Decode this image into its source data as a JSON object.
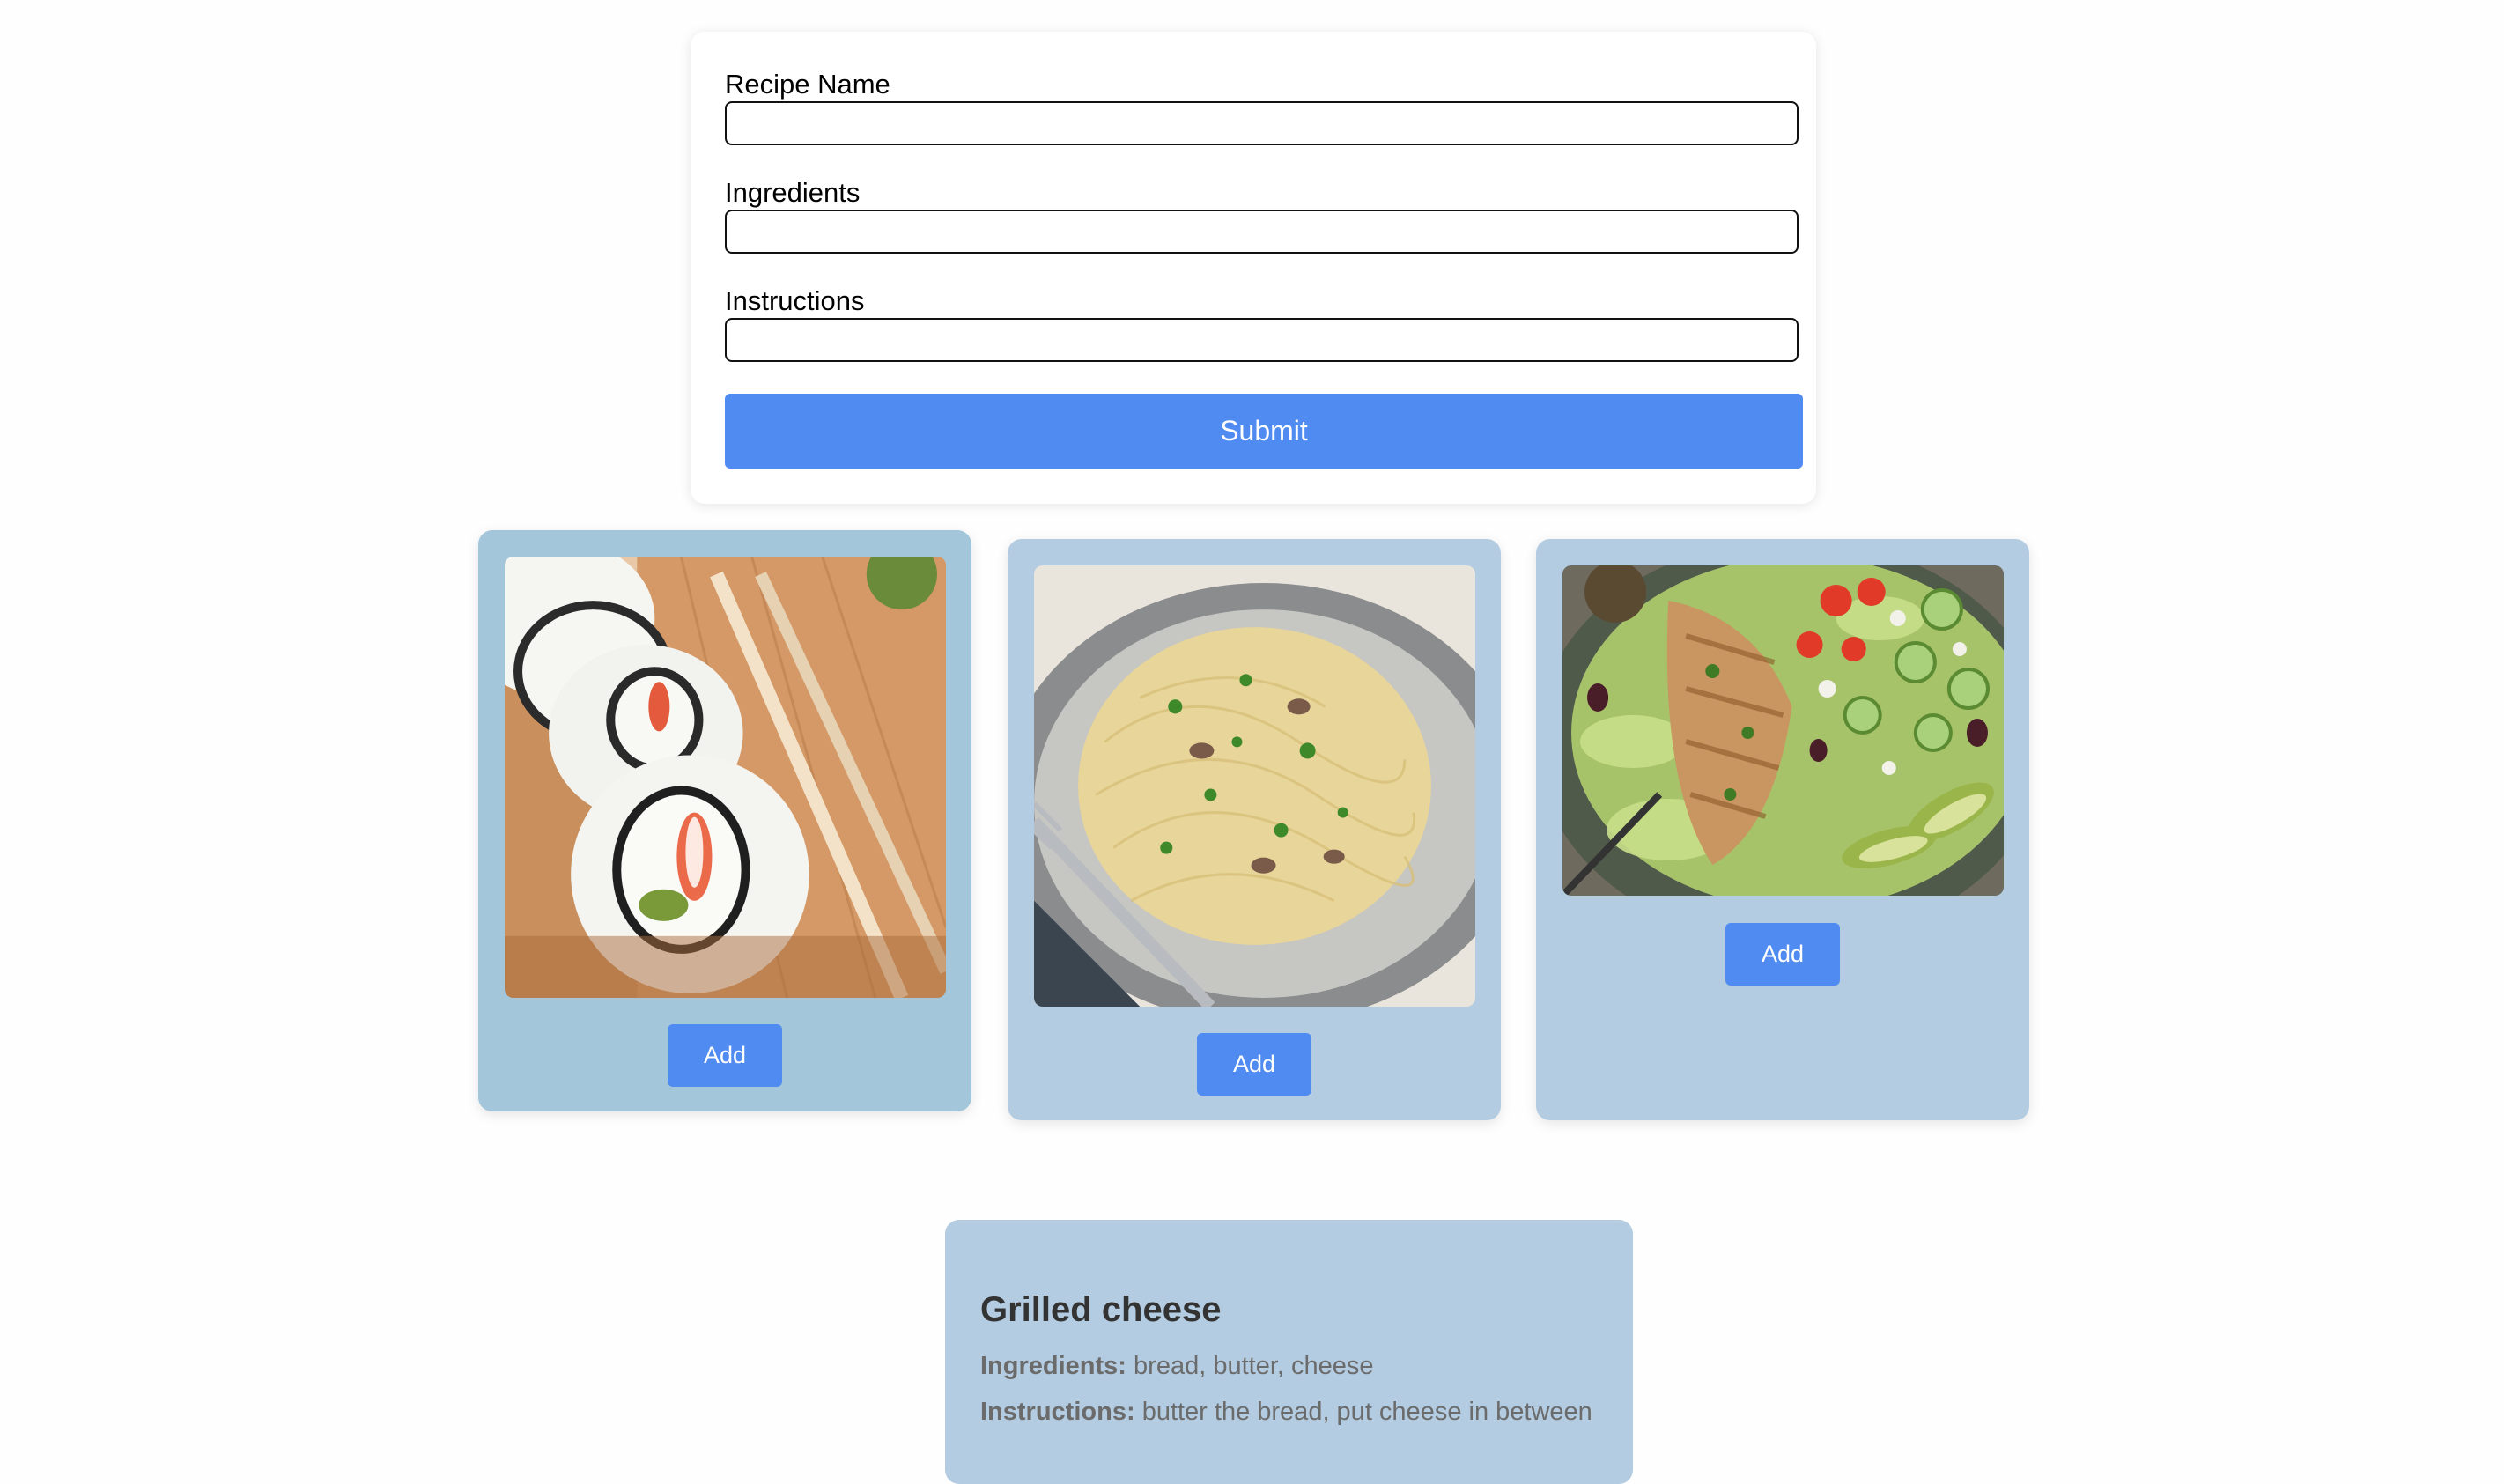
{
  "form": {
    "recipe_name_label": "Recipe Name",
    "recipe_name_value": "",
    "ingredients_label": "Ingredients",
    "ingredients_value": "",
    "instructions_label": "Instructions",
    "instructions_value": "",
    "submit_label": "Submit"
  },
  "cards": [
    {
      "image": "sushi-roll-photo",
      "add_label": "Add",
      "background": "#a3c6db"
    },
    {
      "image": "spaghetti-carbonara-photo",
      "add_label": "Add",
      "background": "#b3cce1"
    },
    {
      "image": "chicken-salad-photo",
      "add_label": "Add",
      "background": "#b3cce1"
    }
  ],
  "detail": {
    "title": "Grilled cheese",
    "ingredients_label": "Ingredients:",
    "ingredients_text": "bread, butter, cheese",
    "instructions_label": "Instructions:",
    "instructions_text": "butter the bread, put cheese in between"
  },
  "colors": {
    "accent": "#4f8bf0",
    "card_bg": "#b3cce1",
    "card_bg_hover": "#a3c6db"
  }
}
